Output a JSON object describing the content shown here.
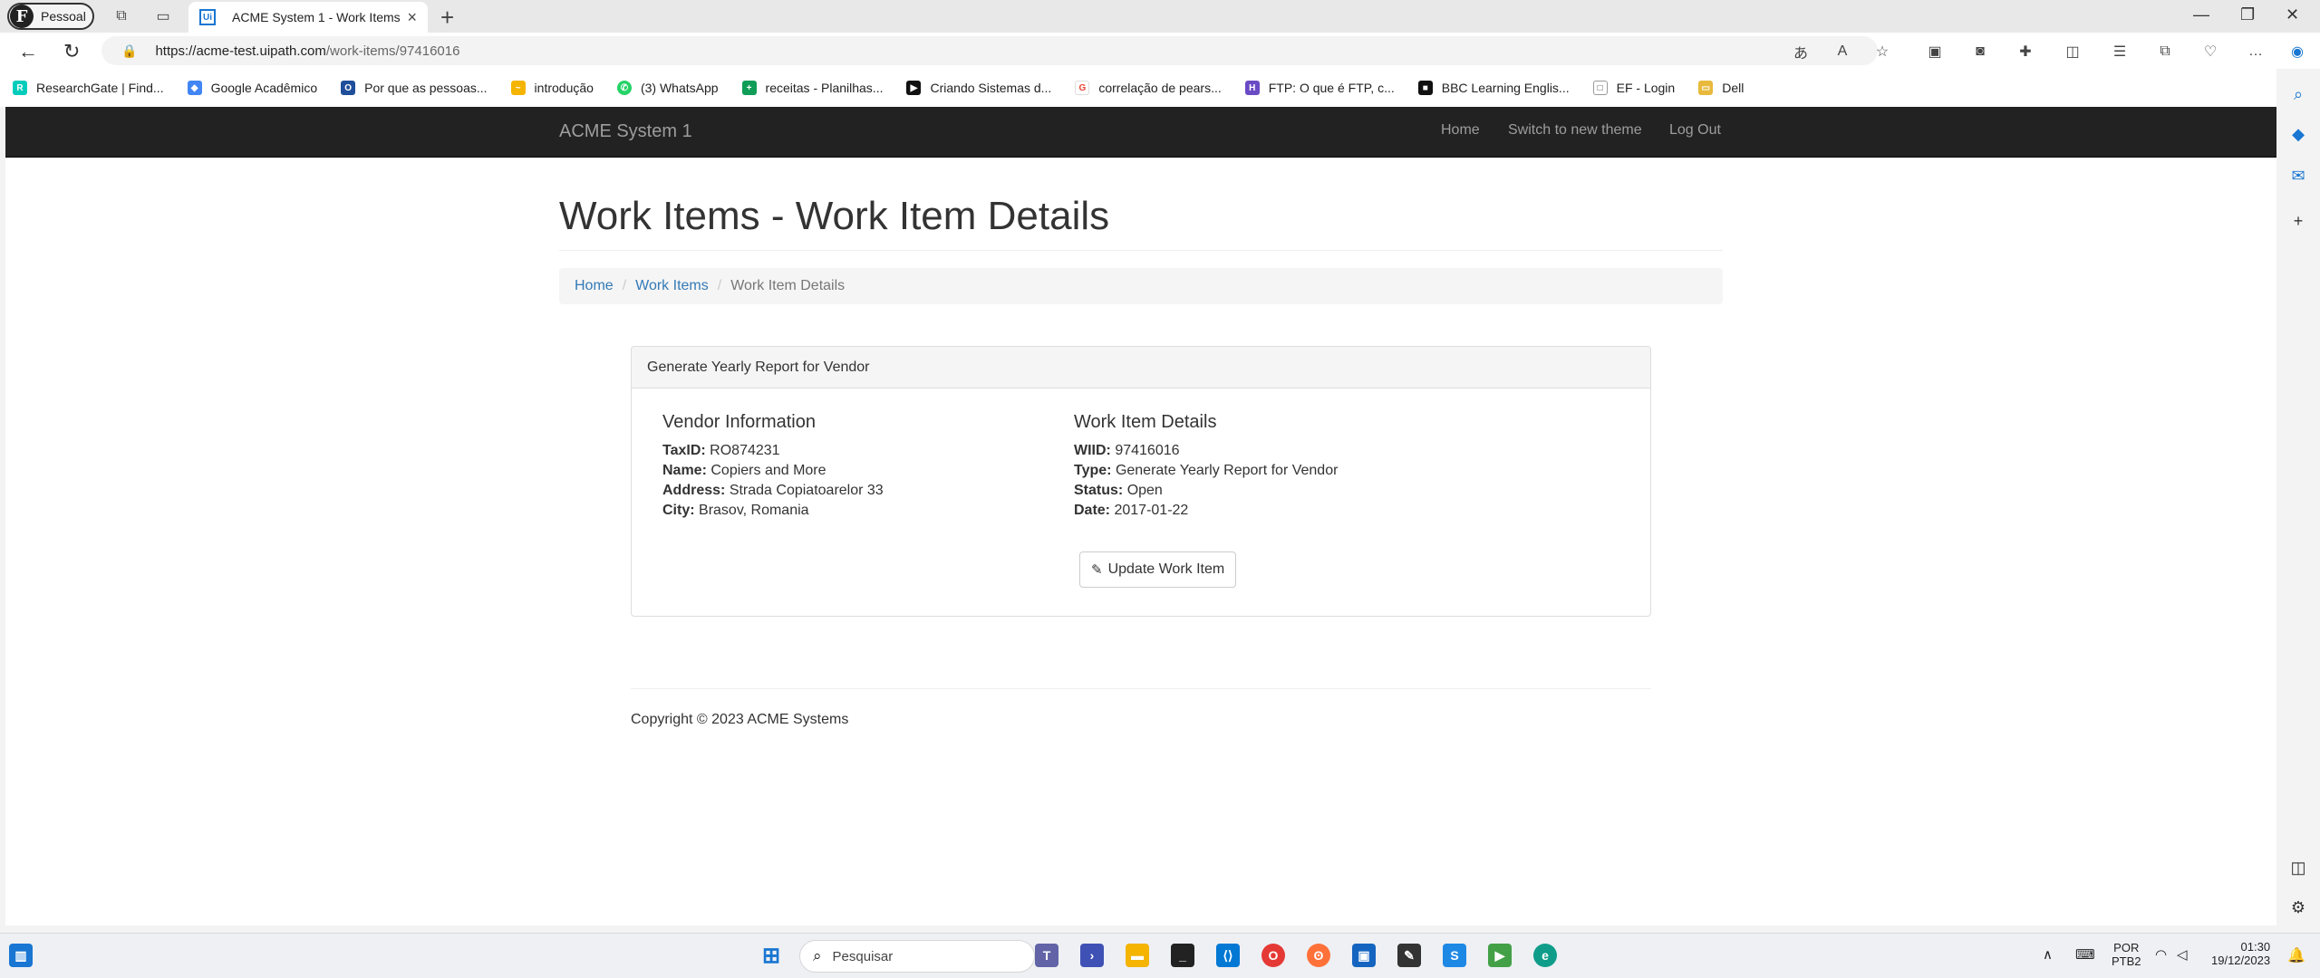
{
  "browser": {
    "profile_label": "Pessoal",
    "profile_initial": "F",
    "tab_title": "ACME System 1 - Work Items",
    "tab_favicon": "Ui",
    "url_host": "https://acme-test.uipath.com",
    "url_path": "/work-items/97416016"
  },
  "bookmarks": [
    {
      "label": "ResearchGate | Find...",
      "color": "#00ccbb",
      "glyph": "R"
    },
    {
      "label": "Google Acadêmico",
      "color": "#4285f4",
      "glyph": "◆"
    },
    {
      "label": "Por que as pessoas...",
      "color": "#1f4e9a",
      "glyph": "O"
    },
    {
      "label": "introdução",
      "color": "#f4b400",
      "glyph": "~"
    },
    {
      "label": "(3) WhatsApp",
      "color": "#25d366",
      "glyph": "✆"
    },
    {
      "label": "receitas - Planilhas...",
      "color": "#0f9d58",
      "glyph": "+"
    },
    {
      "label": "Criando Sistemas d...",
      "color": "#111111",
      "glyph": "▶"
    },
    {
      "label": "correlação de pears...",
      "color": "#ea4335",
      "glyph": "G"
    },
    {
      "label": "FTP: O que é FTP, c...",
      "color": "#6a4bc4",
      "glyph": "H"
    },
    {
      "label": "BBC Learning Englis...",
      "color": "#111111",
      "glyph": "■"
    },
    {
      "label": "EF - Login",
      "color": "#777777",
      "glyph": "□"
    },
    {
      "label": "Dell",
      "color": "#e8b93c",
      "glyph": "▭"
    }
  ],
  "site": {
    "brand": "ACME System 1",
    "nav": {
      "home": "Home",
      "theme": "Switch to new theme",
      "logout": "Log Out"
    },
    "page_title": "Work Items - Work Item Details",
    "breadcrumb": {
      "home": "Home",
      "work_items": "Work Items",
      "current": "Work Item Details"
    },
    "panel_heading": "Generate Yearly Report for Vendor",
    "vendor": {
      "heading": "Vendor Information",
      "taxid_label": "TaxID:",
      "taxid": "RO874231",
      "name_label": "Name:",
      "name": "Copiers and More",
      "address_label": "Address:",
      "address": "Strada Copiatoarelor 33",
      "city_label": "City:",
      "city": "Brasov, Romania"
    },
    "details": {
      "heading": "Work Item Details",
      "wiid_label": "WIID:",
      "wiid": "97416016",
      "type_label": "Type:",
      "type": "Generate Yearly Report for Vendor",
      "status_label": "Status:",
      "status": "Open",
      "date_label": "Date:",
      "date": "2017-01-22"
    },
    "update_button": "Update Work Item",
    "footer": "Copyright © 2023 ACME Systems"
  },
  "taskbar": {
    "search_placeholder": "Pesquisar",
    "lang_top": "POR",
    "lang_bottom": "PTB2",
    "time": "01:30",
    "date": "19/12/2023"
  },
  "colors": {
    "navbar": "#222222",
    "link": "#337ab7",
    "accent": "#1976d2"
  }
}
